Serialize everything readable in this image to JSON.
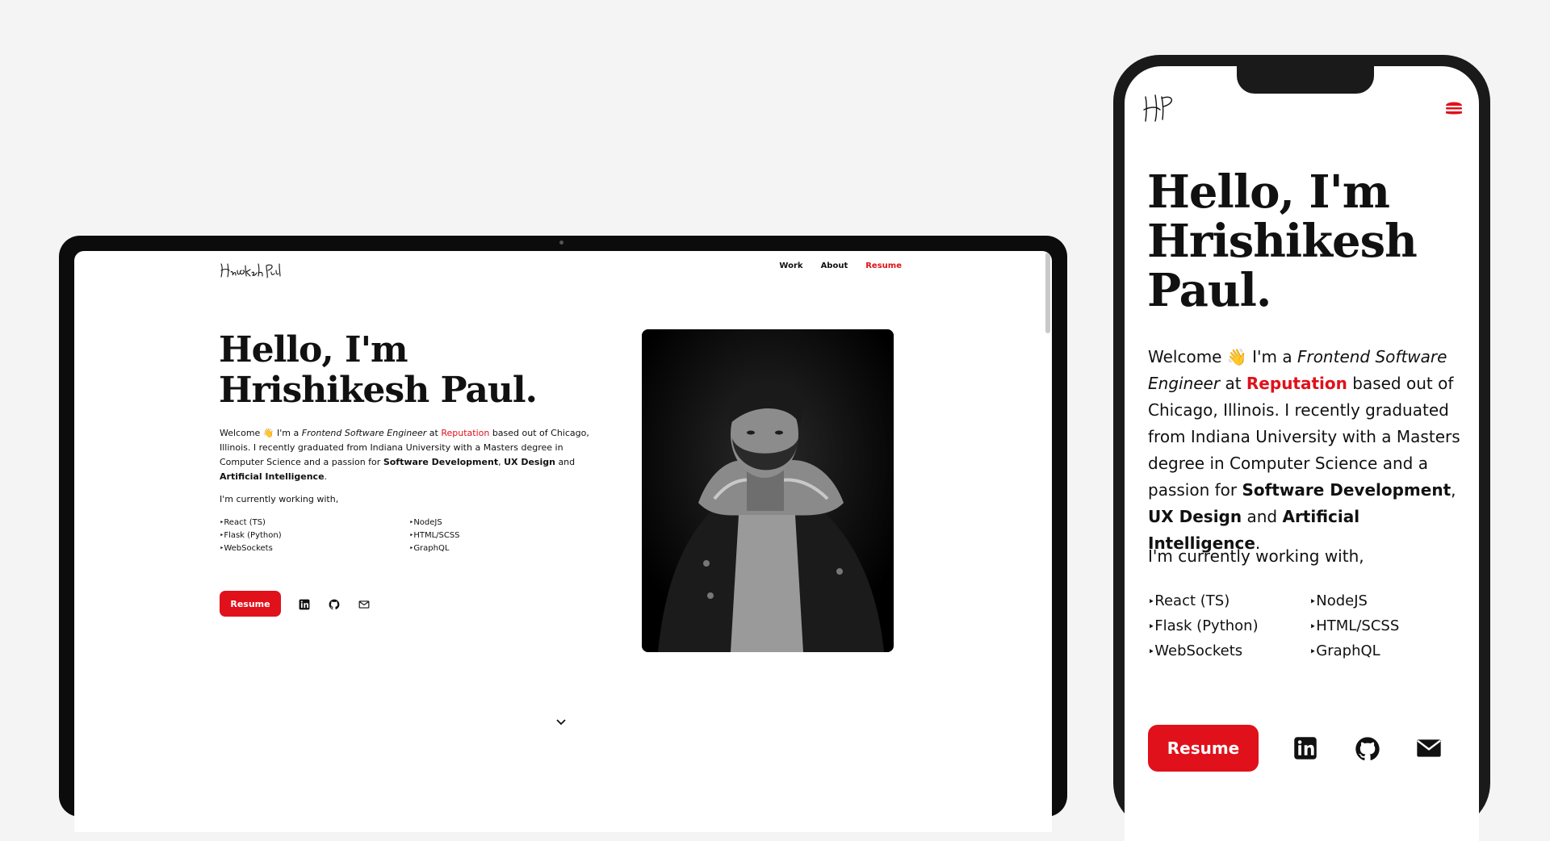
{
  "colors": {
    "accent": "#e0111a",
    "text": "#111111",
    "background": "#f4f4f4"
  },
  "site": {
    "logo_text": "Hrishikesh Paul",
    "logo_monogram": "HP",
    "nav": [
      "Work",
      "About",
      "Resume"
    ],
    "title_line1": "Hello, I'm",
    "title_line2": "Hrishikesh Paul.",
    "title_name_first": "Hrishikesh",
    "title_name_last": "Paul.",
    "intro": {
      "welcome": "Welcome",
      "wave": "👋",
      "im_a": "I'm a",
      "role": "Frontend Software Engineer",
      "role_part1": "Frontend Software",
      "role_part2": "Engineer",
      "at": "at",
      "company": "Reputation",
      "location": "based out of Chicago, Illinois. I recently graduated from Indiana University with a Masters degree in Computer Science and a passion for",
      "skill1": "Software Development",
      "skill2": "UX Design",
      "and": "and",
      "skill3": "Artificial Intelligence"
    },
    "working_with": "I'm currently working with,",
    "tech": [
      "React (TS)",
      "NodeJS",
      "Flask (Python)",
      "HTML/SCSS",
      "WebSockets",
      "GraphQL"
    ],
    "resume_button": "Resume",
    "social_icons": [
      "linkedin-icon",
      "github-icon",
      "mail-icon"
    ],
    "scroll_icon": "chevron-down-icon",
    "menu_icon": "hamburger-icon"
  }
}
